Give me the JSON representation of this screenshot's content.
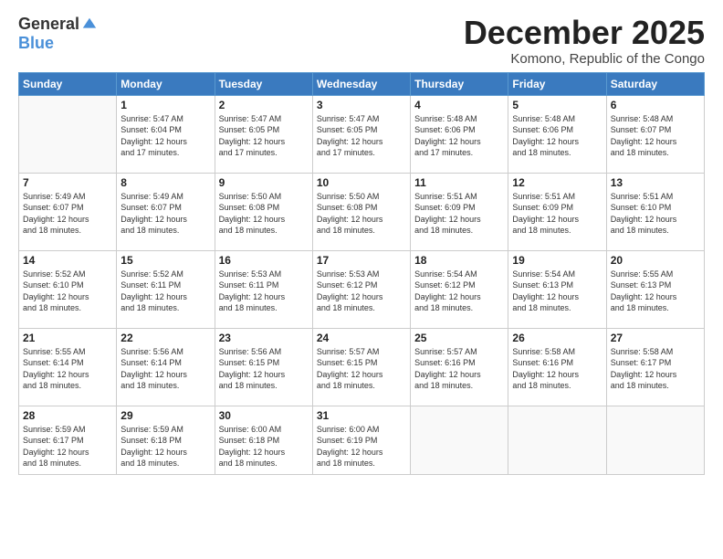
{
  "logo": {
    "general": "General",
    "blue": "Blue"
  },
  "header": {
    "month": "December 2025",
    "location": "Komono, Republic of the Congo"
  },
  "weekdays": [
    "Sunday",
    "Monday",
    "Tuesday",
    "Wednesday",
    "Thursday",
    "Friday",
    "Saturday"
  ],
  "weeks": [
    [
      {
        "day": "",
        "info": ""
      },
      {
        "day": "1",
        "info": "Sunrise: 5:47 AM\nSunset: 6:04 PM\nDaylight: 12 hours\nand 17 minutes."
      },
      {
        "day": "2",
        "info": "Sunrise: 5:47 AM\nSunset: 6:05 PM\nDaylight: 12 hours\nand 17 minutes."
      },
      {
        "day": "3",
        "info": "Sunrise: 5:47 AM\nSunset: 6:05 PM\nDaylight: 12 hours\nand 17 minutes."
      },
      {
        "day": "4",
        "info": "Sunrise: 5:48 AM\nSunset: 6:06 PM\nDaylight: 12 hours\nand 17 minutes."
      },
      {
        "day": "5",
        "info": "Sunrise: 5:48 AM\nSunset: 6:06 PM\nDaylight: 12 hours\nand 18 minutes."
      },
      {
        "day": "6",
        "info": "Sunrise: 5:48 AM\nSunset: 6:07 PM\nDaylight: 12 hours\nand 18 minutes."
      }
    ],
    [
      {
        "day": "7",
        "info": "Sunrise: 5:49 AM\nSunset: 6:07 PM\nDaylight: 12 hours\nand 18 minutes."
      },
      {
        "day": "8",
        "info": "Sunrise: 5:49 AM\nSunset: 6:07 PM\nDaylight: 12 hours\nand 18 minutes."
      },
      {
        "day": "9",
        "info": "Sunrise: 5:50 AM\nSunset: 6:08 PM\nDaylight: 12 hours\nand 18 minutes."
      },
      {
        "day": "10",
        "info": "Sunrise: 5:50 AM\nSunset: 6:08 PM\nDaylight: 12 hours\nand 18 minutes."
      },
      {
        "day": "11",
        "info": "Sunrise: 5:51 AM\nSunset: 6:09 PM\nDaylight: 12 hours\nand 18 minutes."
      },
      {
        "day": "12",
        "info": "Sunrise: 5:51 AM\nSunset: 6:09 PM\nDaylight: 12 hours\nand 18 minutes."
      },
      {
        "day": "13",
        "info": "Sunrise: 5:51 AM\nSunset: 6:10 PM\nDaylight: 12 hours\nand 18 minutes."
      }
    ],
    [
      {
        "day": "14",
        "info": "Sunrise: 5:52 AM\nSunset: 6:10 PM\nDaylight: 12 hours\nand 18 minutes."
      },
      {
        "day": "15",
        "info": "Sunrise: 5:52 AM\nSunset: 6:11 PM\nDaylight: 12 hours\nand 18 minutes."
      },
      {
        "day": "16",
        "info": "Sunrise: 5:53 AM\nSunset: 6:11 PM\nDaylight: 12 hours\nand 18 minutes."
      },
      {
        "day": "17",
        "info": "Sunrise: 5:53 AM\nSunset: 6:12 PM\nDaylight: 12 hours\nand 18 minutes."
      },
      {
        "day": "18",
        "info": "Sunrise: 5:54 AM\nSunset: 6:12 PM\nDaylight: 12 hours\nand 18 minutes."
      },
      {
        "day": "19",
        "info": "Sunrise: 5:54 AM\nSunset: 6:13 PM\nDaylight: 12 hours\nand 18 minutes."
      },
      {
        "day": "20",
        "info": "Sunrise: 5:55 AM\nSunset: 6:13 PM\nDaylight: 12 hours\nand 18 minutes."
      }
    ],
    [
      {
        "day": "21",
        "info": "Sunrise: 5:55 AM\nSunset: 6:14 PM\nDaylight: 12 hours\nand 18 minutes."
      },
      {
        "day": "22",
        "info": "Sunrise: 5:56 AM\nSunset: 6:14 PM\nDaylight: 12 hours\nand 18 minutes."
      },
      {
        "day": "23",
        "info": "Sunrise: 5:56 AM\nSunset: 6:15 PM\nDaylight: 12 hours\nand 18 minutes."
      },
      {
        "day": "24",
        "info": "Sunrise: 5:57 AM\nSunset: 6:15 PM\nDaylight: 12 hours\nand 18 minutes."
      },
      {
        "day": "25",
        "info": "Sunrise: 5:57 AM\nSunset: 6:16 PM\nDaylight: 12 hours\nand 18 minutes."
      },
      {
        "day": "26",
        "info": "Sunrise: 5:58 AM\nSunset: 6:16 PM\nDaylight: 12 hours\nand 18 minutes."
      },
      {
        "day": "27",
        "info": "Sunrise: 5:58 AM\nSunset: 6:17 PM\nDaylight: 12 hours\nand 18 minutes."
      }
    ],
    [
      {
        "day": "28",
        "info": "Sunrise: 5:59 AM\nSunset: 6:17 PM\nDaylight: 12 hours\nand 18 minutes."
      },
      {
        "day": "29",
        "info": "Sunrise: 5:59 AM\nSunset: 6:18 PM\nDaylight: 12 hours\nand 18 minutes."
      },
      {
        "day": "30",
        "info": "Sunrise: 6:00 AM\nSunset: 6:18 PM\nDaylight: 12 hours\nand 18 minutes."
      },
      {
        "day": "31",
        "info": "Sunrise: 6:00 AM\nSunset: 6:19 PM\nDaylight: 12 hours\nand 18 minutes."
      },
      {
        "day": "",
        "info": ""
      },
      {
        "day": "",
        "info": ""
      },
      {
        "day": "",
        "info": ""
      }
    ]
  ]
}
